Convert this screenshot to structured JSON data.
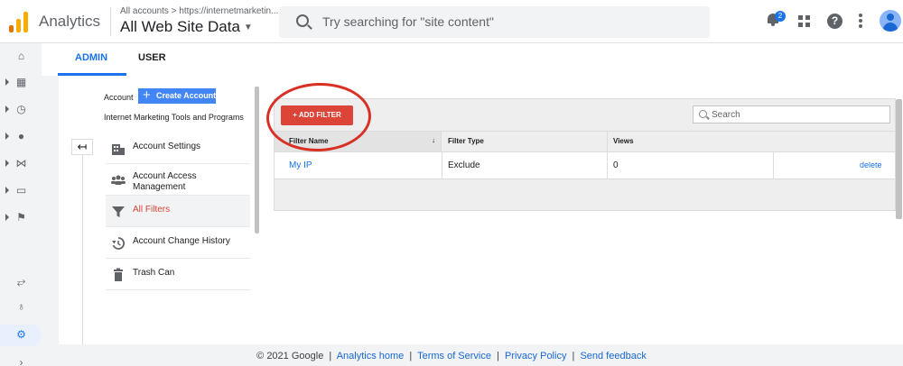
{
  "header": {
    "app_name": "Analytics",
    "account_path": "All accounts > https://internetmarketin...",
    "view_name": "All Web Site Data",
    "search_placeholder": "Try searching for \"site content\"",
    "notification_count": "2",
    "help_label": "?"
  },
  "rail": {
    "items": [
      "home",
      "customization",
      "realtime",
      "audience",
      "acquisition",
      "behavior",
      "conversions"
    ],
    "bottom_items": [
      "attribution",
      "discover",
      "admin",
      "expand"
    ]
  },
  "tabs": {
    "admin": "ADMIN",
    "user": "USER"
  },
  "account": {
    "label": "Account",
    "create_button": "Create Account",
    "name": "Internet Marketing Tools and Programs",
    "back_icon": "↤"
  },
  "menu": {
    "items": [
      {
        "label": "Account Settings",
        "icon": "building-icon"
      },
      {
        "label": "Account Access Management",
        "icon": "people-icon"
      },
      {
        "label": "All Filters",
        "icon": "filter-icon",
        "active": true
      },
      {
        "label": "Account Change History",
        "icon": "history-icon"
      },
      {
        "label": "Trash Can",
        "icon": "trash-icon"
      }
    ]
  },
  "filters": {
    "add_button": "+ ADD FILTER",
    "search_placeholder": "Search",
    "columns": [
      "Filter Name",
      "Filter Type",
      "Views"
    ],
    "rows": [
      {
        "name": "My IP",
        "type": "Exclude",
        "views": "0",
        "action": "delete"
      }
    ]
  },
  "footer": {
    "copyright": "© 2021 Google",
    "links": [
      "Analytics home",
      "Terms of Service",
      "Privacy Policy",
      "Send feedback"
    ],
    "separator": "|"
  },
  "colors": {
    "accent": "#1a73e8",
    "add_filter": "#db4437",
    "annotation_circle": "#d93025"
  }
}
